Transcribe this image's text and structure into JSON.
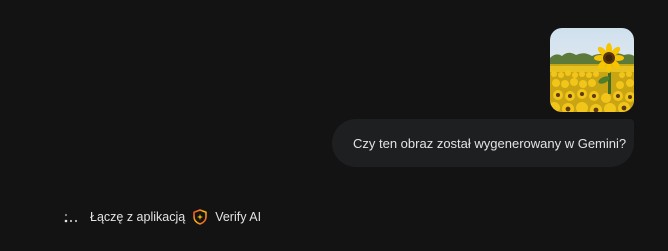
{
  "user_message": {
    "image_alt": "sunflower-field",
    "text": "Czy ten obraz został wygenerowany w Gemini?"
  },
  "status": {
    "icon": "loading-dots-icon",
    "label": "Łączę z aplikacją",
    "app_icon": "verify-ai-shield-icon",
    "app_name": "Verify AI"
  },
  "colors": {
    "background": "#131314",
    "bubble": "#1e1f20",
    "text": "#e3e3e3"
  }
}
